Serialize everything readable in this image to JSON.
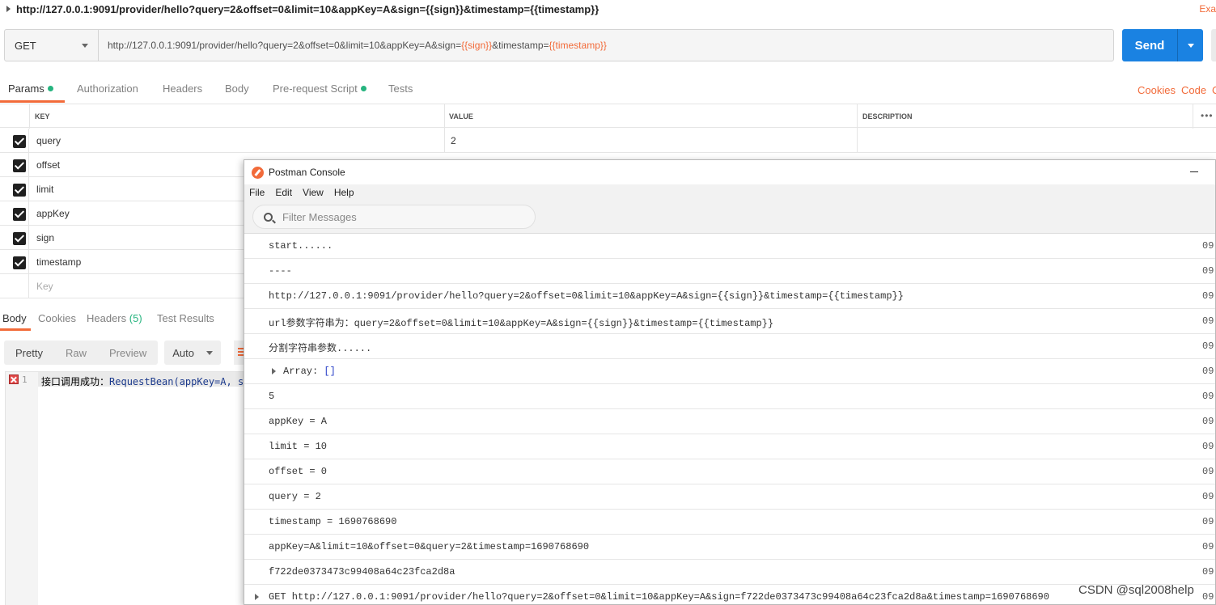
{
  "window": {
    "title_url": "http://127.0.0.1:9091/provider/hello?query=2&offset=0&limit=10&appKey=A&sign={{sign}}&timestamp={{timestamp}}",
    "examples_label": "Exa"
  },
  "request": {
    "method": "GET",
    "url_prefix": "http://127.0.0.1:9091/provider/hello?query=2&offset=0&limit=10&appKey=A&sign=",
    "url_var_sign": "{{sign}}",
    "url_mid": "&timestamp=",
    "url_var_timestamp": "{{timestamp}}",
    "send_label": "Send"
  },
  "request_tabs": {
    "params": "Params",
    "authorization": "Authorization",
    "headers": "Headers",
    "body": "Body",
    "prerequest": "Pre-request Script",
    "tests": "Tests",
    "cookies": "Cookies",
    "code": "Code",
    "cut": "C"
  },
  "params_table": {
    "headers": {
      "key": "KEY",
      "value": "VALUE",
      "description": "DESCRIPTION",
      "more": "•••"
    },
    "rows": [
      {
        "key": "query",
        "value": "2"
      },
      {
        "key": "offset",
        "value": ""
      },
      {
        "key": "limit",
        "value": ""
      },
      {
        "key": "appKey",
        "value": ""
      },
      {
        "key": "sign",
        "value": ""
      },
      {
        "key": "timestamp",
        "value": ""
      }
    ],
    "new_key_placeholder": "Key"
  },
  "response": {
    "tabs": {
      "body": "Body",
      "cookies": "Cookies",
      "headers": "Headers",
      "headers_count": "(5)",
      "test_results": "Test Results"
    },
    "formats": {
      "pretty": "Pretty",
      "raw": "Raw",
      "preview": "Preview",
      "auto": "Auto"
    },
    "line_number": "1",
    "line_text_cn": "接口调用成功：",
    "line_text_code": "RequestBean(appKey=A, si"
  },
  "console": {
    "title": "Postman Console",
    "menu": {
      "file": "File",
      "edit": "Edit",
      "view": "View",
      "help": "Help"
    },
    "filter_placeholder": "Filter Messages",
    "logs": [
      {
        "text": "start......",
        "time": "09"
      },
      {
        "text": "----",
        "time": "09"
      },
      {
        "text": "http://127.0.0.1:9091/provider/hello?query=2&offset=0&limit=10&appKey=A&sign={{sign}}&timestamp={{timestamp}}",
        "time": "09"
      },
      {
        "text": "url参数字符串为：query=2&offset=0&limit=10&appKey=A&sign={{sign}}&timestamp={{timestamp}}",
        "time": "09"
      },
      {
        "text": "分割字符串参数......",
        "time": "09"
      },
      {
        "text": "Array: ",
        "bracket": "[]",
        "time": "09"
      },
      {
        "text": "5",
        "time": "09"
      },
      {
        "text": "appKey = A",
        "time": "09"
      },
      {
        "text": "limit = 10",
        "time": "09"
      },
      {
        "text": "offset = 0",
        "time": "09"
      },
      {
        "text": "query = 2",
        "time": "09"
      },
      {
        "text": "timestamp = 1690768690",
        "time": "09"
      },
      {
        "text": "appKey=A&limit=10&offset=0&query=2&timestamp=1690768690",
        "time": "09"
      },
      {
        "text": "f722de0373473c99408a64c23fca2d8a",
        "time": "09"
      },
      {
        "text": "GET  http://127.0.0.1:9091/provider/hello?query=2&offset=0&limit=10&appKey=A&sign=f722de0373473c99408a64c23fca2d8a&timestamp=1690768690",
        "time": "09"
      }
    ]
  },
  "watermark": "CSDN @sql2008help"
}
